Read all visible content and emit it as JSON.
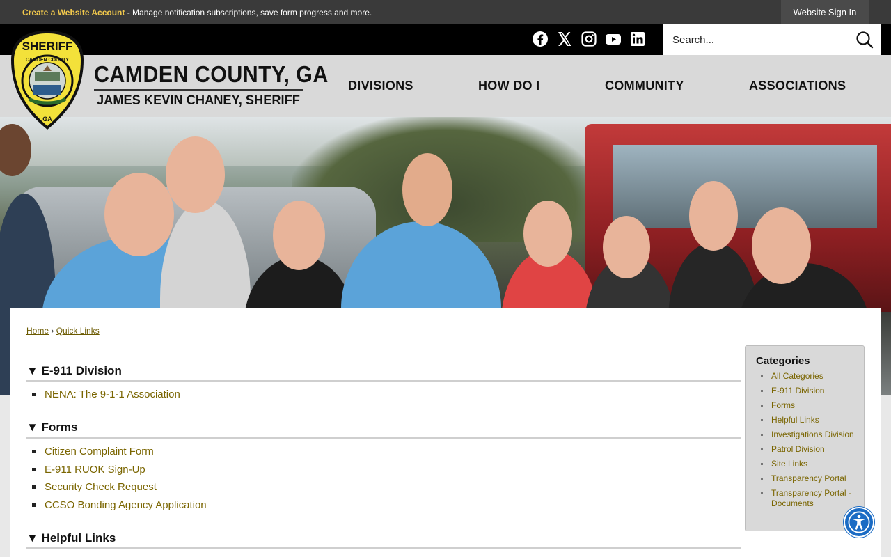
{
  "topbar": {
    "create_account": "Create a Website Account",
    "message": " - Manage notification subscriptions, save form progress and more.",
    "signin": "Website Sign In"
  },
  "social": [
    "facebook-icon",
    "x-twitter-icon",
    "instagram-icon",
    "youtube-icon",
    "linkedin-icon"
  ],
  "search": {
    "placeholder": "Search..."
  },
  "header": {
    "badge_top": "SHERIFF",
    "badge_ring": "CAMDEN COUNTY",
    "badge_bottom": "GA",
    "title": "CAMDEN COUNTY, GA",
    "subtitle": "JAMES KEVIN CHANEY, SHERIFF"
  },
  "nav": [
    "DIVISIONS",
    "HOW DO I",
    "COMMUNITY",
    "ASSOCIATIONS"
  ],
  "breadcrumb": {
    "home": "Home",
    "sep": "›",
    "current": "Quick Links"
  },
  "sections": [
    {
      "title": "▼ E-911 Division",
      "links": [
        "NENA: The 9-1-1 Association"
      ]
    },
    {
      "title": "▼ Forms",
      "links": [
        "Citizen Complaint Form",
        "E-911 RUOK Sign-Up",
        "Security Check Request",
        "CCSO Bonding Agency Application"
      ]
    },
    {
      "title": "▼ Helpful Links",
      "links": []
    }
  ],
  "categories": {
    "title": "Categories",
    "items": [
      "All Categories",
      "E-911 Division",
      "Forms",
      "Helpful Links",
      "Investigations Division",
      "Patrol Division",
      "Site Links",
      "Transparency Portal",
      "Transparency Portal - Documents"
    ]
  },
  "colors": {
    "accent_link": "#7a6500",
    "topbar_link": "#f2c94c",
    "accessibility": "#1c6cc4"
  }
}
